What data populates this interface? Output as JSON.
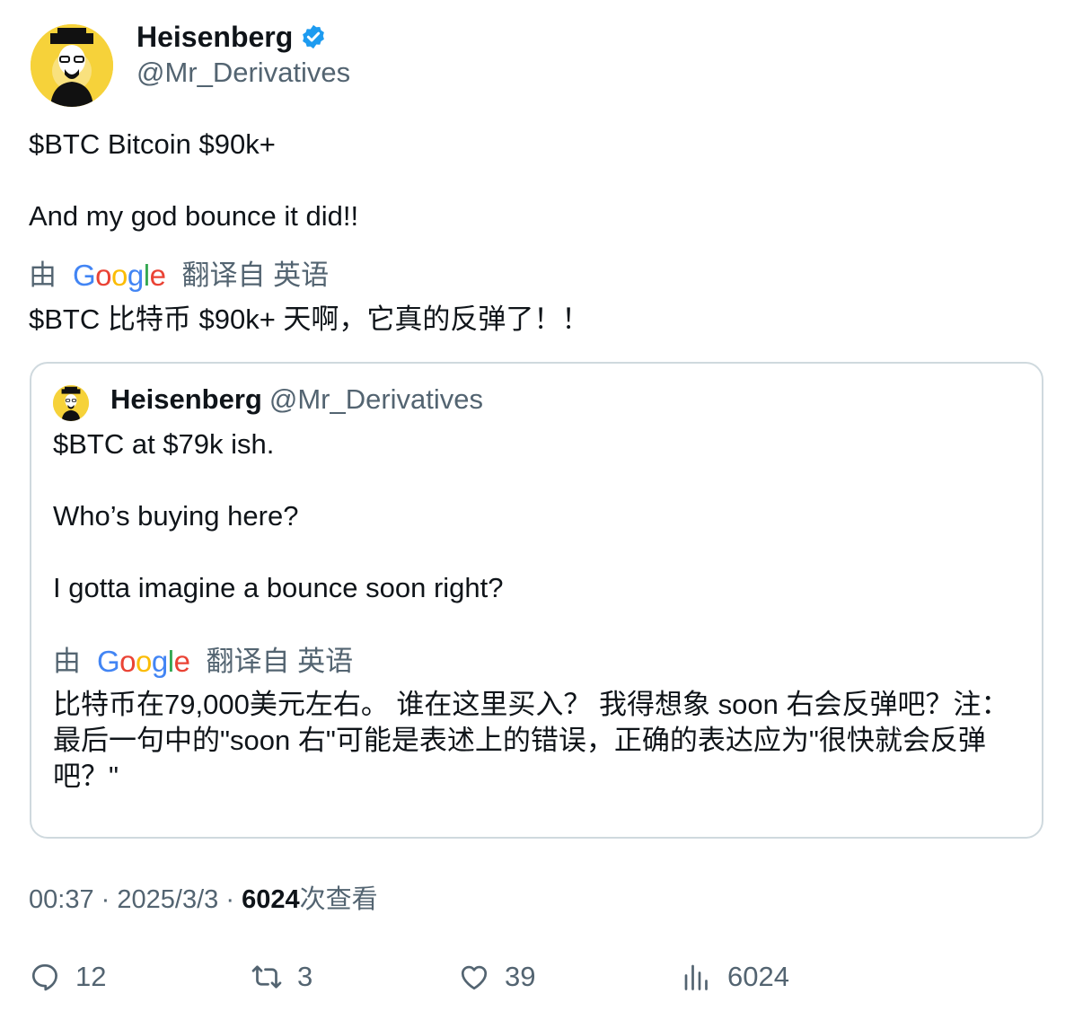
{
  "author": {
    "name": "Heisenberg",
    "handle": "@Mr_Derivatives"
  },
  "tweet": {
    "line1": "$BTC Bitcoin $90k+",
    "line2": "And my god bounce it did!!",
    "translation": {
      "prefix": "由",
      "google": [
        "G",
        "o",
        "o",
        "g",
        "l",
        "e"
      ],
      "suffix": "翻译自 英语",
      "text": "$BTC 比特币 $90k+ 天啊，它真的反弹了！！"
    }
  },
  "quote": {
    "name": "Heisenberg",
    "handle": "@Mr_Derivatives",
    "line1": "$BTC at $79k ish.",
    "line2": "Who’s buying here?",
    "line3": "I gotta imagine a bounce soon right?",
    "translation": {
      "prefix": "由",
      "suffix": "翻译自 英语",
      "text": "比特币在79,000美元左右。 谁在这里买入？ 我得想象 soon 右会反弹吧？注：最后一句中的\"soon 右\"可能是表述上的错误，正确的表达应为\"很快就会反弹吧？\""
    }
  },
  "meta": {
    "time": "00:37",
    "date": "2025/3/3",
    "views": "6024",
    "views_label": "次查看",
    "sep": "·"
  },
  "actions": {
    "replies": "12",
    "retweets": "3",
    "likes": "39",
    "views": "6024"
  },
  "colors": {
    "verified": "#1d9bf0",
    "secondary_text": "#536471",
    "border": "#cfd9de",
    "avatar_bg": "#f6d23a"
  }
}
